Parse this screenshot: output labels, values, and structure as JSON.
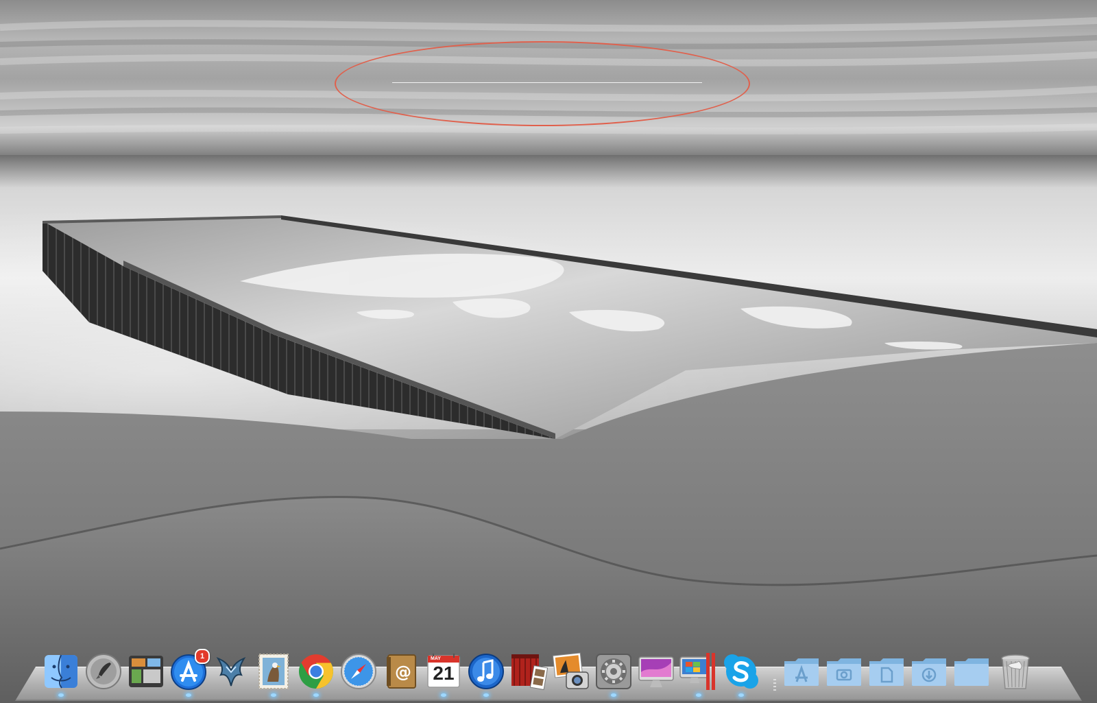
{
  "desktop": {
    "highlight_color": "#e0604c"
  },
  "dock": {
    "apps": [
      {
        "id": "finder",
        "icon": "finder-icon",
        "running": true
      },
      {
        "id": "launchpad",
        "icon": "launchpad-rocket-icon",
        "running": false
      },
      {
        "id": "mission-control",
        "icon": "mission-control-icon",
        "running": false
      },
      {
        "id": "app-store",
        "icon": "app-store-icon",
        "running": true,
        "badge": "1"
      },
      {
        "id": "starcraft",
        "icon": "starcraft-icon",
        "running": false
      },
      {
        "id": "mail",
        "icon": "mail-stamp-icon",
        "running": true
      },
      {
        "id": "chrome",
        "icon": "chrome-icon",
        "running": true
      },
      {
        "id": "safari",
        "icon": "safari-compass-icon",
        "running": false
      },
      {
        "id": "address-book",
        "icon": "address-book-icon",
        "running": false
      },
      {
        "id": "calendar",
        "icon": "calendar-icon",
        "running": true,
        "month": "MAY",
        "day": "21"
      },
      {
        "id": "itunes",
        "icon": "itunes-note-icon",
        "running": true
      },
      {
        "id": "photo-booth",
        "icon": "photo-booth-icon",
        "running": false
      },
      {
        "id": "iphoto",
        "icon": "iphoto-icon",
        "running": false
      },
      {
        "id": "system-preferences",
        "icon": "gear-icon",
        "running": true
      },
      {
        "id": "imac",
        "icon": "imac-icon",
        "running": false
      },
      {
        "id": "parallels",
        "icon": "parallels-icon",
        "running": true
      },
      {
        "id": "skype",
        "icon": "skype-icon",
        "running": true
      }
    ],
    "stacks": [
      {
        "id": "applications",
        "icon": "applications-folder-icon"
      },
      {
        "id": "pictures",
        "icon": "pictures-folder-icon"
      },
      {
        "id": "documents",
        "icon": "documents-folder-icon"
      },
      {
        "id": "downloads",
        "icon": "downloads-folder-icon"
      },
      {
        "id": "generic-folder",
        "icon": "folder-icon"
      },
      {
        "id": "trash",
        "icon": "trash-icon"
      }
    ]
  }
}
